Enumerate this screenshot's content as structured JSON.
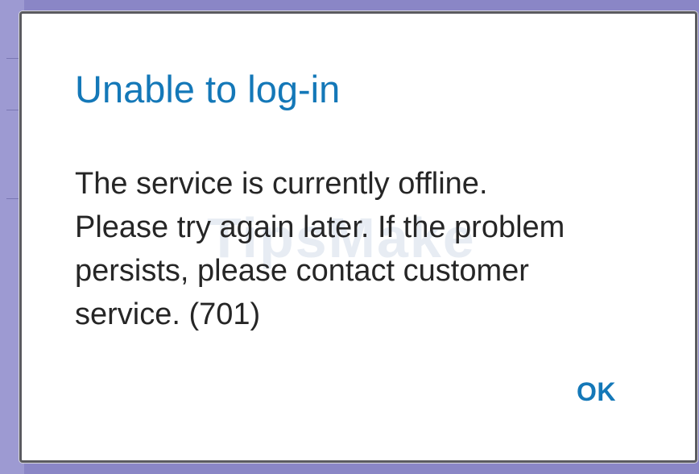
{
  "dialog": {
    "title": "Unable to log-in",
    "message_lines": [
      "The service is currently offline.",
      "Please try again later. If the problem",
      "persists, please contact customer",
      "service. (701)"
    ],
    "ok_label": "OK"
  },
  "watermark": "TipsMake",
  "colors": {
    "accent": "#1478b8",
    "text": "#262626",
    "dialog_background": "#ffffff",
    "backdrop": "#8a86c6"
  }
}
